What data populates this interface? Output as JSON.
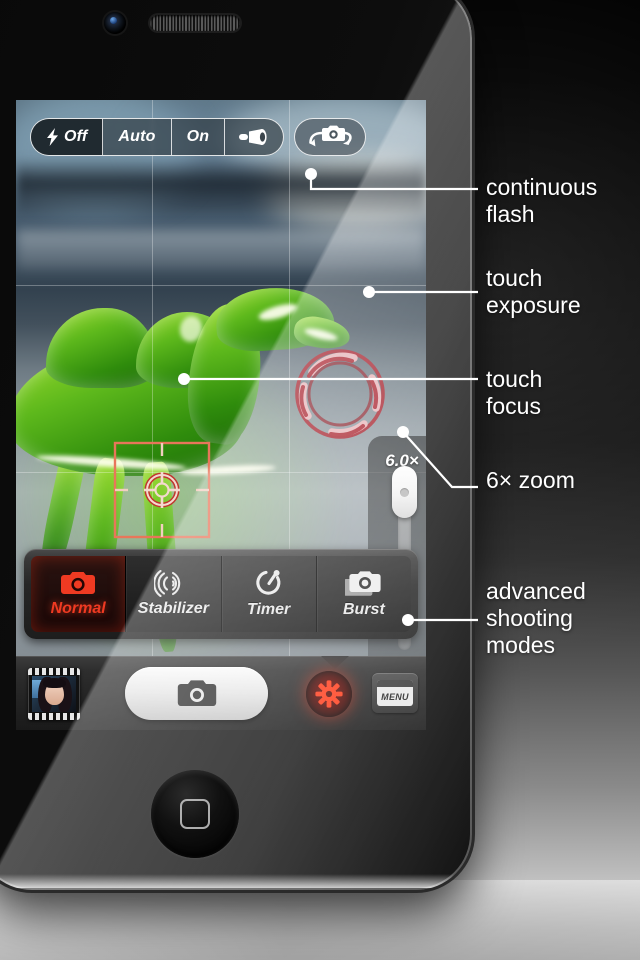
{
  "device": {
    "name": "smartphone-mockup",
    "front_camera": "front-camera-icon",
    "earpiece": "earpiece-speaker-icon",
    "home_button": "home-button-icon"
  },
  "camera_ui": {
    "flash_bar": {
      "name": "flash-mode-selector",
      "options": [
        {
          "label": "Off",
          "icon": "flash-bolt-icon",
          "selected": true
        },
        {
          "label": "Auto",
          "icon": "",
          "selected": false
        },
        {
          "label": "On",
          "icon": "",
          "selected": false
        },
        {
          "label": "",
          "icon": "torch-icon",
          "selected": false
        }
      ],
      "flip_button": {
        "icon": "camera-flip-icon",
        "label": ""
      }
    },
    "viewfinder": {
      "subject": "green glass camel figurine on a window sill",
      "grid": "rule-of-thirds",
      "exposure_indicator": {
        "name": "touch-exposure-ring",
        "color": "#b3262f"
      },
      "focus_indicator": {
        "name": "touch-focus-box",
        "color": "#e8674a"
      }
    },
    "zoom": {
      "label": "6.0×",
      "value": 6.0,
      "min": 1.0,
      "max": 6.0,
      "knob_position_pct": 100
    },
    "modes": {
      "name": "shooting-mode-bar",
      "items": [
        {
          "label": "Normal",
          "icon": "camera-icon",
          "active": true
        },
        {
          "label": "Stabilizer",
          "icon": "stabilizer-icon",
          "active": false
        },
        {
          "label": "Timer",
          "icon": "timer-icon",
          "active": false
        },
        {
          "label": "Burst",
          "icon": "burst-camera-icon",
          "active": false
        }
      ],
      "active_color": "#ef3a22"
    },
    "bottom_bar": {
      "thumbnail": {
        "name": "gallery-thumbnail",
        "label": ""
      },
      "shutter": {
        "name": "shutter-button",
        "icon": "camera-icon",
        "label": ""
      },
      "settings": {
        "name": "settings-gear-button",
        "icon": "gear-icon",
        "label": ""
      },
      "menu": {
        "name": "menu-button",
        "icon": "menu-window-icon",
        "label": "MENU"
      }
    }
  },
  "annotations": [
    {
      "id": "continuous-flash",
      "lines": [
        "continuous",
        "flash"
      ]
    },
    {
      "id": "touch-exposure",
      "lines": [
        "touch",
        "exposure"
      ]
    },
    {
      "id": "touch-focus",
      "lines": [
        "touch",
        "focus"
      ]
    },
    {
      "id": "6x-zoom",
      "lines": [
        "6× zoom"
      ]
    },
    {
      "id": "advanced-shooting-modes",
      "lines": [
        "advanced",
        "shooting",
        "modes"
      ]
    }
  ],
  "colors": {
    "accent_red": "#ef3a22",
    "exposure_red": "#b3262f",
    "focus_orange": "#e8674a",
    "text_white": "#ffffff"
  }
}
